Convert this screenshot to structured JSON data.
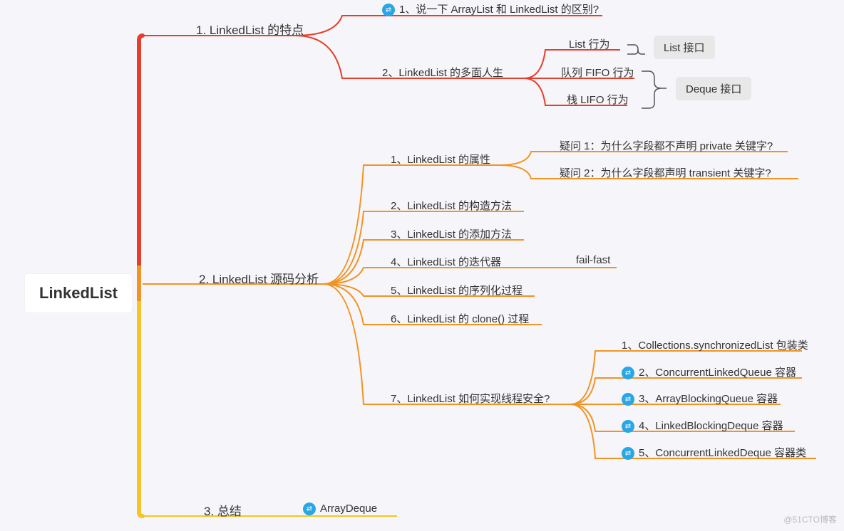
{
  "root": "LinkedList",
  "sections": {
    "s1": "1. LinkedList 的特点",
    "s2": "2. LinkedList 源码分析",
    "s3": "3. 总结"
  },
  "s1_children": {
    "c1": "1、说一下 ArrayList 和 LinkedList 的区别?",
    "c2": "2、LinkedList 的多面人生"
  },
  "s1_c2_children": {
    "a": "List 行为",
    "b": "队列 FIFO 行为",
    "c": "栈 LIFO 行为"
  },
  "badges": {
    "list": "List 接口",
    "deque": "Deque 接口"
  },
  "s2_children": {
    "c1": "1、LinkedList 的属性",
    "c2": "2、LinkedList 的构造方法",
    "c3": "3、LinkedList 的添加方法",
    "c4": "4、LinkedList 的迭代器",
    "c4_extra": "fail-fast",
    "c5": "5、LinkedList 的序列化过程",
    "c6": "6、LinkedList 的 clone() 过程",
    "c7": "7、LinkedList 如何实现线程安全?"
  },
  "s2_c1_children": {
    "q1": "疑问 1：为什么字段都不声明 private 关键字?",
    "q2": "疑问 2：为什么字段都声明 transient 关键字?"
  },
  "s2_c7_children": {
    "t1": "1、Collections.synchronizedList 包装类",
    "t2": "2、ConcurrentLinkedQueue 容器",
    "t3": "3、ArrayBlockingQueue 容器",
    "t4": "4、LinkedBlockingDeque 容器",
    "t5": "5、ConcurrentLinkedDeque 容器类"
  },
  "s3_children": {
    "c1": "ArrayDeque"
  },
  "watermark": "@51CTO博客",
  "colors": {
    "red": "#e73e2b",
    "orange": "#f39322",
    "yellow": "#f7c423"
  }
}
